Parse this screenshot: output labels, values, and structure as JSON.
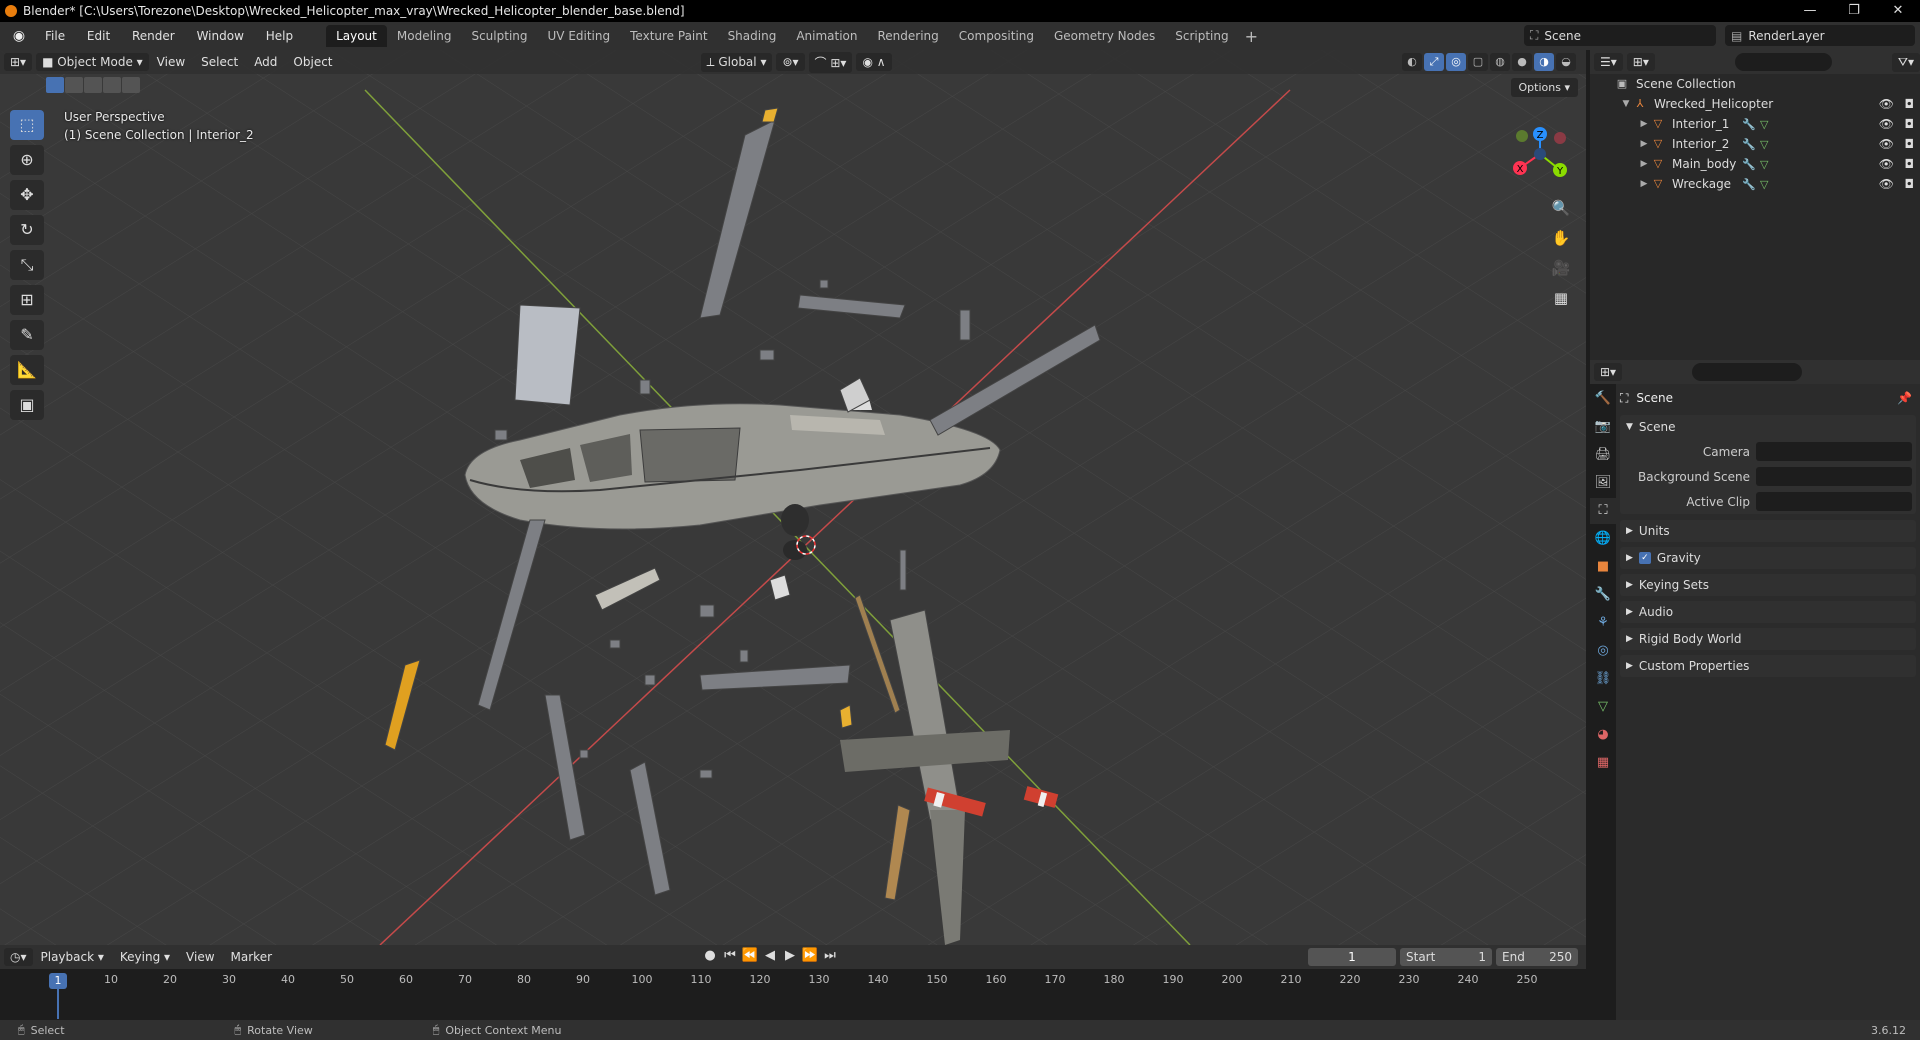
{
  "window": {
    "title": "Blender* [C:\\Users\\Torezone\\Desktop\\Wrecked_Helicopter_max_vray\\Wrecked_Helicopter_blender_base.blend]",
    "minimize": "—",
    "maximize": "❐",
    "close": "✕"
  },
  "menu": {
    "items": [
      "File",
      "Edit",
      "Render",
      "Window",
      "Help"
    ]
  },
  "workspaces": [
    "Layout",
    "Modeling",
    "Sculpting",
    "UV Editing",
    "Texture Paint",
    "Shading",
    "Animation",
    "Rendering",
    "Compositing",
    "Geometry Nodes",
    "Scripting"
  ],
  "active_workspace": "Layout",
  "scene_selector": "Scene",
  "layer_selector": "RenderLayer",
  "viewport": {
    "mode": "Object Mode",
    "menus": [
      "View",
      "Select",
      "Add",
      "Object"
    ],
    "transform_orientation": "Global",
    "options": "Options",
    "perspective": "User Perspective",
    "context": "(1) Scene Collection | Interior_2",
    "gizmo_labels": {
      "x": "X",
      "y": "Y",
      "z": "Z"
    }
  },
  "timeline": {
    "menus": [
      "Playback",
      "Keying",
      "View",
      "Marker"
    ],
    "current_frame": "1",
    "start_label": "Start",
    "start_value": "1",
    "end_label": "End",
    "end_value": "250",
    "frame_marks": [
      "10",
      "20",
      "30",
      "40",
      "50",
      "60",
      "70",
      "80",
      "90",
      "100",
      "110",
      "120",
      "130",
      "140",
      "150",
      "160",
      "170",
      "180",
      "190",
      "200",
      "210",
      "220",
      "230",
      "240",
      "250"
    ],
    "playhead": "1"
  },
  "outliner": {
    "root": "Scene Collection",
    "collection": "Wrecked_Helicopter",
    "objects": [
      "Interior_1",
      "Interior_2",
      "Main_body",
      "Wreckage"
    ]
  },
  "properties": {
    "scene_title": "Scene",
    "panel_title": "Scene",
    "camera_label": "Camera",
    "background_scene_label": "Background Scene",
    "active_clip_label": "Active Clip",
    "subpanels": [
      "Units",
      "Gravity",
      "Keying Sets",
      "Audio",
      "Rigid Body World",
      "Custom Properties"
    ]
  },
  "statusbar": {
    "select": "Select",
    "rotate": "Rotate View",
    "context_menu": "Object Context Menu",
    "version": "3.6.12"
  },
  "colors": {
    "accent": "#4772b3",
    "x_axis": "#ff3352",
    "y_axis": "#8bdc00",
    "z_axis": "#2890ff",
    "object_orange": "#e8853d"
  }
}
